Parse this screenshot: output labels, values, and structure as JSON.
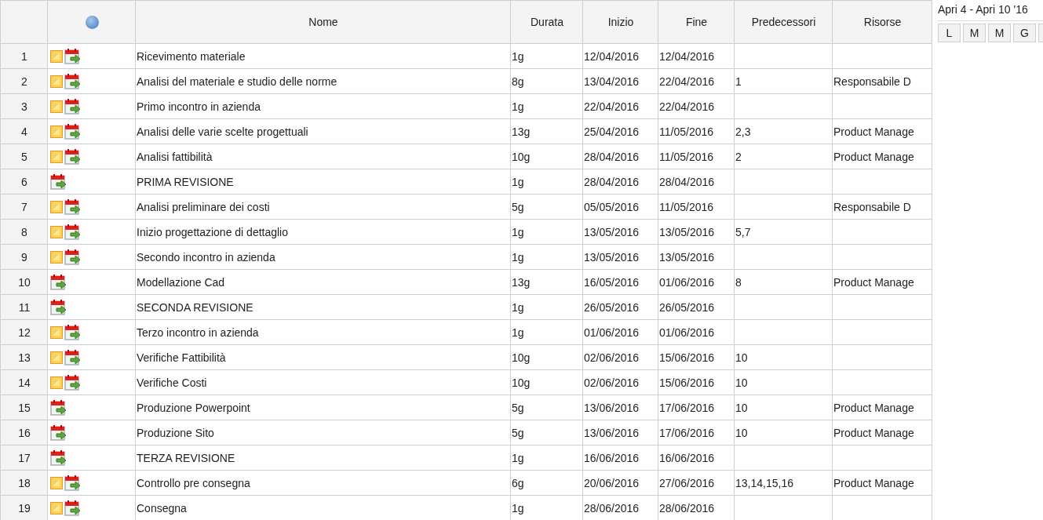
{
  "table": {
    "columns": [
      "Nome",
      "Durata",
      "Inizio",
      "Fine",
      "Predecessori",
      "Risorse"
    ],
    "rows": [
      {
        "num": "1",
        "note": true,
        "name": "Ricevimento materiale",
        "duration": "1g",
        "start": "12/04/2016",
        "end": "12/04/2016",
        "predecessors": "",
        "resources": ""
      },
      {
        "num": "2",
        "note": true,
        "name": "Analisi del materiale e studio delle norme",
        "duration": "8g",
        "start": "13/04/2016",
        "end": "22/04/2016",
        "predecessors": "1",
        "resources": "Responsabile D"
      },
      {
        "num": "3",
        "note": true,
        "name": "Primo incontro in azienda",
        "duration": "1g",
        "start": "22/04/2016",
        "end": "22/04/2016",
        "predecessors": "",
        "resources": ""
      },
      {
        "num": "4",
        "note": true,
        "name": "Analisi delle varie scelte progettuali",
        "duration": "13g",
        "start": "25/04/2016",
        "end": "11/05/2016",
        "predecessors": "2,3",
        "resources": "Product Manage"
      },
      {
        "num": "5",
        "note": true,
        "name": "Analisi fattibilità",
        "duration": "10g",
        "start": "28/04/2016",
        "end": "11/05/2016",
        "predecessors": "2",
        "resources": "Product Manage"
      },
      {
        "num": "6",
        "note": false,
        "name": "PRIMA REVISIONE",
        "duration": "1g",
        "start": "28/04/2016",
        "end": "28/04/2016",
        "predecessors": "",
        "resources": ""
      },
      {
        "num": "7",
        "note": true,
        "name": "Analisi preliminare dei costi",
        "duration": "5g",
        "start": "05/05/2016",
        "end": "11/05/2016",
        "predecessors": "",
        "resources": "Responsabile D"
      },
      {
        "num": "8",
        "note": true,
        "name": "Inizio progettazione di dettaglio",
        "duration": "1g",
        "start": "13/05/2016",
        "end": "13/05/2016",
        "predecessors": "5,7",
        "resources": ""
      },
      {
        "num": "9",
        "note": true,
        "name": "Secondo incontro in azienda",
        "duration": "1g",
        "start": "13/05/2016",
        "end": "13/05/2016",
        "predecessors": "",
        "resources": ""
      },
      {
        "num": "10",
        "note": false,
        "name": "Modellazione Cad",
        "duration": "13g",
        "start": "16/05/2016",
        "end": "01/06/2016",
        "predecessors": "8",
        "resources": "Product Manage"
      },
      {
        "num": "11",
        "note": false,
        "name": "SECONDA REVISIONE",
        "duration": "1g",
        "start": "26/05/2016",
        "end": "26/05/2016",
        "predecessors": "",
        "resources": ""
      },
      {
        "num": "12",
        "note": true,
        "name": "Terzo incontro in azienda",
        "duration": "1g",
        "start": "01/06/2016",
        "end": "01/06/2016",
        "predecessors": "",
        "resources": ""
      },
      {
        "num": "13",
        "note": true,
        "name": "Verifiche Fattibilità",
        "duration": "10g",
        "start": "02/06/2016",
        "end": "15/06/2016",
        "predecessors": "10",
        "resources": ""
      },
      {
        "num": "14",
        "note": true,
        "name": "Verifiche Costi",
        "duration": "10g",
        "start": "02/06/2016",
        "end": "15/06/2016",
        "predecessors": "10",
        "resources": ""
      },
      {
        "num": "15",
        "note": false,
        "name": "Produzione Powerpoint",
        "duration": "5g",
        "start": "13/06/2016",
        "end": "17/06/2016",
        "predecessors": "10",
        "resources": "Product Manage"
      },
      {
        "num": "16",
        "note": false,
        "name": "Produzione Sito",
        "duration": "5g",
        "start": "13/06/2016",
        "end": "17/06/2016",
        "predecessors": "10",
        "resources": "Product Manage"
      },
      {
        "num": "17",
        "note": false,
        "name": "TERZA REVISIONE",
        "duration": "1g",
        "start": "16/06/2016",
        "end": "16/06/2016",
        "predecessors": "",
        "resources": ""
      },
      {
        "num": "18",
        "note": true,
        "name": "Controllo pre consegna",
        "duration": "6g",
        "start": "20/06/2016",
        "end": "27/06/2016",
        "predecessors": "13,14,15,16",
        "resources": "Product Manage"
      },
      {
        "num": "19",
        "note": true,
        "name": "Consegna",
        "duration": "1g",
        "start": "28/06/2016",
        "end": "28/06/2016",
        "predecessors": "",
        "resources": ""
      }
    ]
  },
  "gantt": {
    "week": "Apri 4 - Apri 10 '16",
    "days": [
      "L",
      "M",
      "M",
      "G"
    ]
  }
}
